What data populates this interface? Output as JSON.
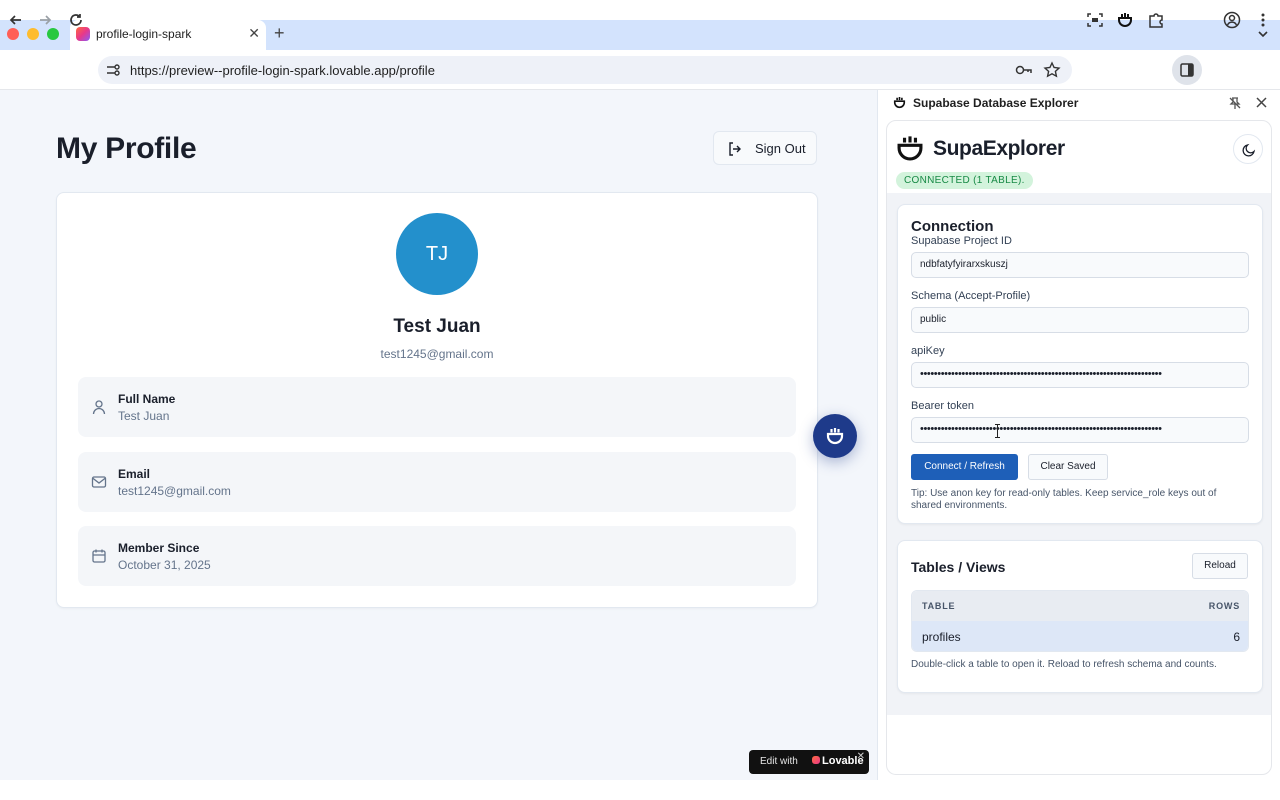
{
  "browser": {
    "tab_title": "profile-login-spark",
    "new_tab_label": "+",
    "url": "https://preview--profile-login-spark.lovable.app/profile"
  },
  "page": {
    "title": "My Profile",
    "sign_out_label": "Sign Out",
    "avatar_initials": "TJ",
    "avatar_color": "#2390cc",
    "name": "Test Juan",
    "email": "test1245@gmail.com",
    "fields": [
      {
        "label": "Full Name",
        "value": "Test Juan",
        "icon": "user-icon"
      },
      {
        "label": "Email",
        "value": "test1245@gmail.com",
        "icon": "mail-icon"
      },
      {
        "label": "Member Since",
        "value": "October 31, 2025",
        "icon": "calendar-icon"
      }
    ],
    "badge": {
      "prefix": "Edit with",
      "brand": "Lovable"
    }
  },
  "side_panel": {
    "title": "Supabase Database Explorer",
    "brand": "SupaExplorer",
    "status": "CONNECTED (1 TABLE).",
    "status_color": "#178a45",
    "connection": {
      "heading": "Connection",
      "project_id_label": "Supabase Project ID",
      "project_id_value": "ndbfatyfyirarxskuszj",
      "schema_label": "Schema (Accept-Profile)",
      "schema_value": "public",
      "apikey_label": "apiKey",
      "apikey_value": "••••••••••••••••••••••••••••••••••••••••••••••••••••••••••••••••••••••",
      "bearer_label": "Bearer token",
      "bearer_value": "••••••••••••••••••••••••••••••••••••••••••••••••••••••••••••••••••••••",
      "connect_label": "Connect / Refresh",
      "clear_label": "Clear Saved",
      "tip": "Tip: Use anon key for read-only tables. Keep service_role keys out of shared environments."
    },
    "tables": {
      "heading": "Tables / Views",
      "reload_label": "Reload",
      "col_table": "TABLE",
      "col_rows": "ROWS",
      "rows": [
        {
          "name": "profiles",
          "count": "6"
        }
      ],
      "note": "Double-click a table to open it. Reload to refresh schema and counts."
    }
  },
  "accent_color": "#1e5fb8"
}
